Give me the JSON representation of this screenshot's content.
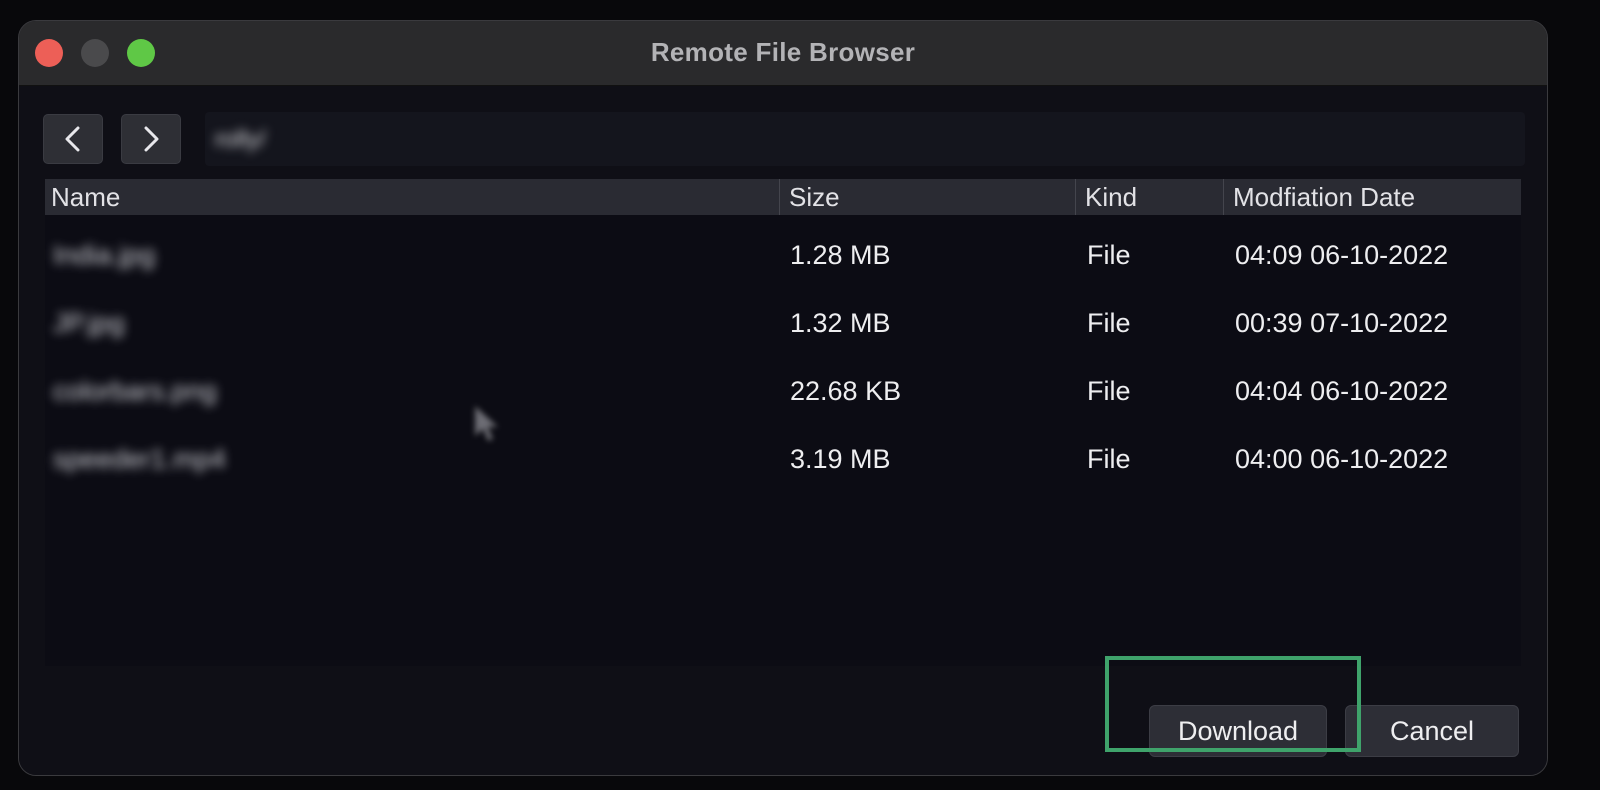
{
  "window": {
    "title": "Remote File Browser"
  },
  "navigation": {
    "back_icon": "chevron-left-icon",
    "forward_icon": "chevron-right-icon",
    "path": "rolly/",
    "path_blurred": true
  },
  "table": {
    "columns": [
      "Name",
      "Size",
      "Kind",
      "Modfiation Date"
    ],
    "rows": [
      {
        "name": "India.jpg",
        "size": "1.28 MB",
        "kind": "File",
        "date": "04:09 06-10-2022"
      },
      {
        "name": "JP.jpg",
        "size": "1.32 MB",
        "kind": "File",
        "date": "00:39 07-10-2022"
      },
      {
        "name": "colorbars.png",
        "size": "22.68 KB",
        "kind": "File",
        "date": "04:04 06-10-2022"
      },
      {
        "name": "speeder1.mp4",
        "size": "3.19 MB",
        "kind": "File",
        "date": "04:00 06-10-2022"
      }
    ]
  },
  "actions": {
    "download_label": "Download",
    "cancel_label": "Cancel"
  },
  "colors": {
    "close": "#ed5f57",
    "minimize": "#4a4a4c",
    "maximize": "#5fc846",
    "highlight": "#3fa36b"
  }
}
